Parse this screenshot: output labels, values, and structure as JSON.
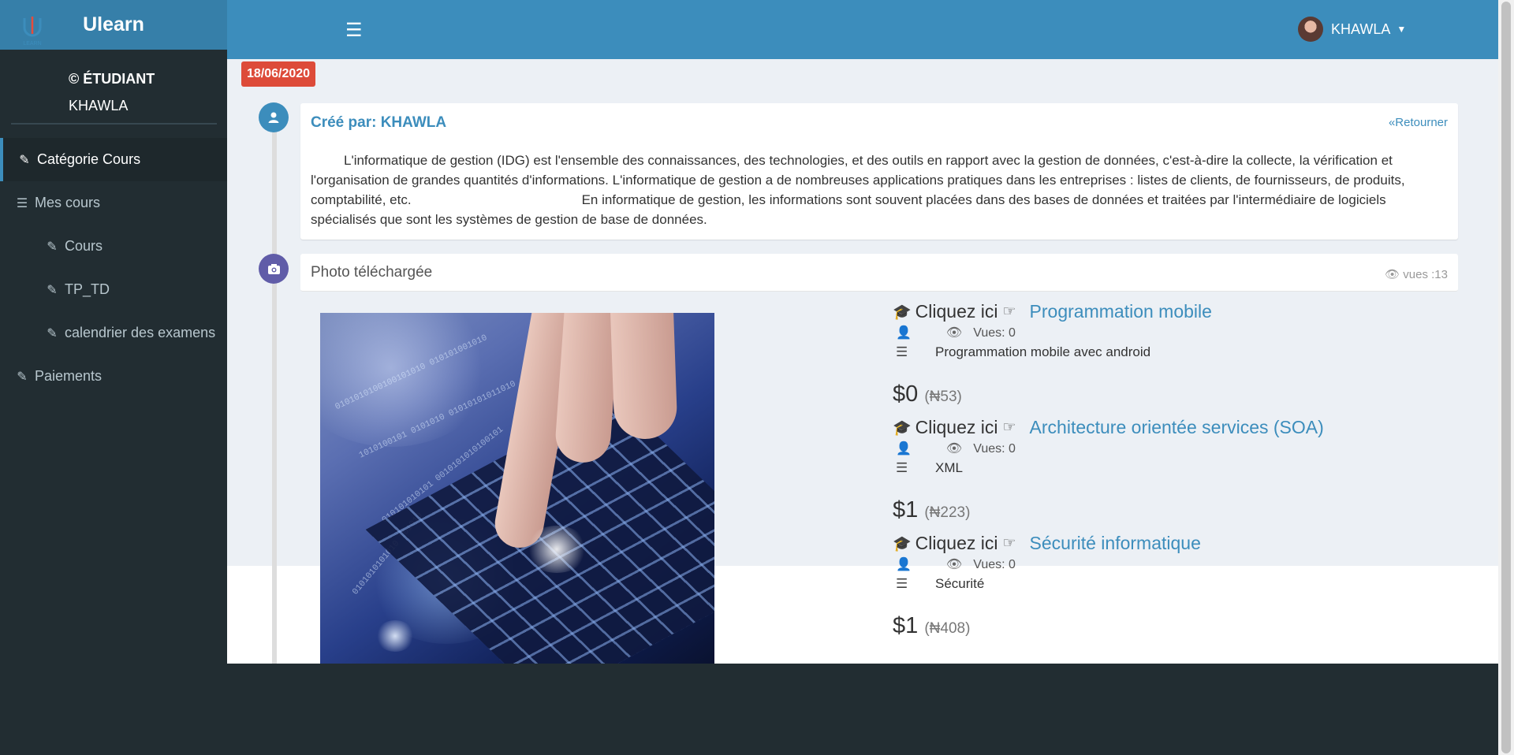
{
  "app": {
    "brand": "Ulearn",
    "logo_text": "LEARN"
  },
  "user": {
    "role": "© ÉTUDIANT",
    "name": "KHAWLA",
    "header_name": "KHAWLA"
  },
  "menu": [
    {
      "label": "Catégorie Cours",
      "icon": "edit-icon",
      "level": "top",
      "active": true
    },
    {
      "label": "Mes cours",
      "icon": "list-icon",
      "level": "top",
      "active": false
    },
    {
      "label": "Cours",
      "icon": "edit-icon",
      "level": "sub",
      "active": false
    },
    {
      "label": "TP_TD",
      "icon": "edit-icon",
      "level": "sub",
      "active": false
    },
    {
      "label": "calendrier des examens",
      "icon": "edit-icon",
      "level": "sub",
      "active": false
    },
    {
      "label": "Paiements",
      "icon": "edit-icon",
      "level": "top",
      "active": false
    }
  ],
  "timeline": {
    "date": "18/06/2020",
    "post": {
      "created_by": "Créé par: KHAWLA",
      "back_link": "«Retourner",
      "paragraph1": "L'informatique de gestion (IDG) est l'ensemble des connaissances, des technologies, et des outils en rapport avec la gestion de données, c'est-à-dire la collecte, la vérification et l'organisation de grandes quantités d'informations. L'informatique de gestion a de nombreuses applications pratiques dans les entreprises : listes de clients, de fournisseurs, de produits, comptabilité, etc.",
      "paragraph2": "En informatique de gestion, les informations sont souvent placées dans des bases de données et traitées par l'intermédiaire de logiciels spécialisés que sont les systèmes de gestion de base de données."
    },
    "photo": {
      "title": "Photo téléchargée",
      "views": "vues :13"
    }
  },
  "courses": [
    {
      "cta": "Cliquez ici",
      "title": "Programmation mobile",
      "views": "Vues: 0",
      "description": "Programmation mobile avec android",
      "price": "$0",
      "price_alt": "(₦53)"
    },
    {
      "cta": "Cliquez ici",
      "title": "Architecture orientée services (SOA)",
      "views": "Vues: 0",
      "description": "XML",
      "price": "$1",
      "price_alt": "(₦223)"
    },
    {
      "cta": "Cliquez ici",
      "title": "Sécurité informatique",
      "views": "Vues: 0",
      "description": "Sécurité",
      "price": "$1",
      "price_alt": "(₦408)"
    }
  ],
  "colors": {
    "header": "#3c8dbc",
    "brand": "#367fa9",
    "sidebar": "#222d32",
    "date_badge": "#dd4b39",
    "photo_icon": "#605ca8"
  }
}
